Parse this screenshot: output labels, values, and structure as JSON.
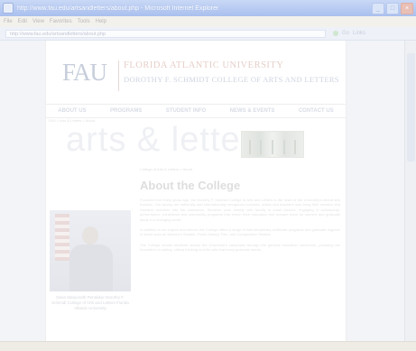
{
  "window": {
    "title": "http://www.fau.edu/artsandletters/about.php - Microsoft Internet Explorer",
    "buttons": [
      "_",
      "□",
      "×"
    ]
  },
  "menu": [
    "File",
    "Edit",
    "View",
    "Favorites",
    "Tools",
    "Help"
  ],
  "address": {
    "url": "http://www.fau.edu/artsandletters/about.php",
    "tools": [
      "Go",
      "Links"
    ]
  },
  "header": {
    "logo": "FAU",
    "university": "FLORIDA ATLANTIC UNIVERSITY",
    "college": "DOROTHY F. SCHMIDT COLLEGE OF ARTS AND LETTERS"
  },
  "nav": [
    "ABOUT US",
    "PROGRAMS",
    "STUDENT INFO",
    "NEWS & EVENTS",
    "CONTACT US"
  ],
  "banner": {
    "text": "arts & letters"
  },
  "breadcrumb": "FAU > Arts & Letters > About",
  "sidebar": {
    "caption": "Dean Manjunath Pendakur Dorothy F. Schmidt College of Arts and Letters Florida Atlantic University"
  },
  "main": {
    "crumb": "College of Arts & Letters > About",
    "title": "About the College",
    "paragraphs": [
      "Founded over thirty years ago, the Dorothy F. Schmidt College of Arts and Letters is the heart of the University's liberal arts tradition. Our faculty are nationally and internationally recognized scholars, artists and teachers who bring their creative and research activities into the classroom. Students work closely with faculty in small classes, engaging in scholarship, performance, exhibitions and community programs that enrich their education and prepare them for careers and graduate study in a changing world.",
      "In addition to our majors and minors, the College offers a range of interdisciplinary certificate programs and graduate degrees in areas such as Women's Studies, Public History, Film, and Comparative Studies.",
      "The College serves students across the University's campuses through the general education curriculum, providing the foundation in writing, critical thinking and the arts that every graduate needs."
    ]
  }
}
